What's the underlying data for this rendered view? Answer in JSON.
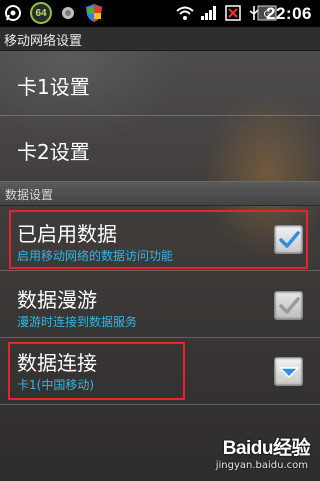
{
  "status_bar": {
    "time": "22:06",
    "badge_number": "64",
    "icons": [
      "whatsapp-icon",
      "badge-64-icon",
      "toggle-icon",
      "shield-icon",
      "wifi-icon",
      "signal-icon",
      "no-signal-icon",
      "usb-icon",
      "network-type-icon",
      "battery-icon"
    ]
  },
  "title_bar": {
    "title": "移动网络设置"
  },
  "items": {
    "card1": {
      "title": "卡1设置"
    },
    "card2": {
      "title": "卡2设置"
    },
    "section_header": "数据设置",
    "data_enabled": {
      "title": "已启用数据",
      "subtitle": "启用移动网络的数据访问功能",
      "checked": true
    },
    "data_roaming": {
      "title": "数据漫游",
      "subtitle": "漫游时连接到数据服务",
      "checked": true,
      "enabled": false
    },
    "data_connection": {
      "title": "数据连接",
      "subtitle": "卡1(中国移动)"
    }
  },
  "watermark": {
    "brand": "Baidu经验",
    "url": "jingyan.baidu.com"
  },
  "colors": {
    "accent_blue": "#33b5e5",
    "highlight_red": "#e8232b",
    "check_blue": "#2f8fe6"
  }
}
